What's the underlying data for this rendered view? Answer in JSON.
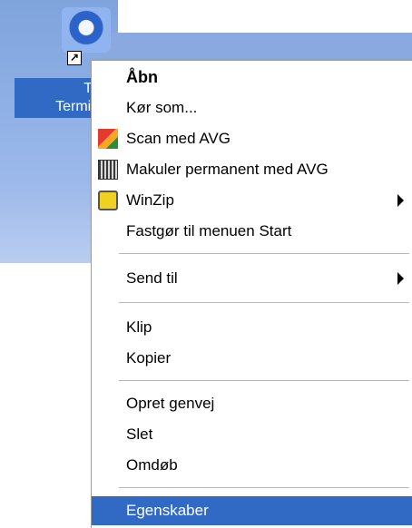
{
  "desktop": {
    "icon_label_lines": [
      "Tau",
      "Termina"
    ],
    "shortcut_arrow_glyph": "↗"
  },
  "menu": {
    "items": [
      {
        "label": "Åbn",
        "icon": null,
        "submenu": false,
        "bold": true
      },
      {
        "label": "Kør som...",
        "icon": null,
        "submenu": false
      },
      {
        "label": "Scan med AVG",
        "icon": "avg-scan-icon",
        "submenu": false
      },
      {
        "label": "Makuler permanent med AVG",
        "icon": "avg-shredder-icon",
        "submenu": false
      },
      {
        "label": "WinZip",
        "icon": "winzip-icon",
        "submenu": true
      },
      {
        "label": "Fastgør til menuen Start",
        "icon": null,
        "submenu": false
      },
      {
        "label": "Send til",
        "icon": null,
        "submenu": true
      },
      {
        "label": "Klip",
        "icon": null,
        "submenu": false
      },
      {
        "label": "Kopier",
        "icon": null,
        "submenu": false
      },
      {
        "label": "Opret genvej",
        "icon": null,
        "submenu": false
      },
      {
        "label": "Slet",
        "icon": null,
        "submenu": false
      },
      {
        "label": "Omdøb",
        "icon": null,
        "submenu": false
      },
      {
        "label": "Egenskaber",
        "icon": null,
        "submenu": false,
        "selected": true
      }
    ]
  },
  "colors": {
    "selection": "#316ac5",
    "separator": "#b6b6b6",
    "desktop": "#8eb0e6"
  }
}
